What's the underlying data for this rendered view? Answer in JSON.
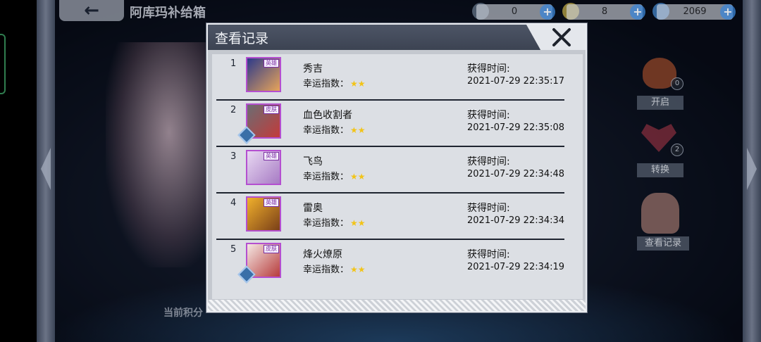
{
  "topbar": {
    "shop_title": "阿库玛补给箱",
    "resources": [
      {
        "icon": "ticket-icon",
        "value": "0"
      },
      {
        "icon": "feather-icon",
        "value": "8"
      },
      {
        "icon": "diamond-icon",
        "value": "2069"
      }
    ],
    "plus_label": "+"
  },
  "side_menu": {
    "open": {
      "label": "开启",
      "badge": "0"
    },
    "exchange": {
      "label": "转换",
      "badge": "2"
    },
    "records": {
      "label": "查看记录"
    }
  },
  "score_label": "当前积分",
  "modal": {
    "title": "查看记录",
    "close_icon": "close-x-icon",
    "rows": [
      {
        "rank": "1",
        "name": "秀吉",
        "luck_label": "幸运指数：",
        "stars": "★★",
        "time_label": "获得时间:",
        "time": "2021-07-29 22:35:17",
        "tag": "英雄",
        "avatar_colors": [
          "#2d3a8a",
          "#e6a35a"
        ],
        "gem": false
      },
      {
        "rank": "2",
        "name": "血色收割者",
        "luck_label": "幸运指数：",
        "stars": "★★",
        "time_label": "获得时间:",
        "time": "2021-07-29 22:35:08",
        "tag": "皮肤",
        "avatar_colors": [
          "#6b6d73",
          "#c23b3b"
        ],
        "gem": true
      },
      {
        "rank": "3",
        "name": "飞鸟",
        "luck_label": "幸运指数：",
        "stars": "★★",
        "time_label": "获得时间:",
        "time": "2021-07-29 22:34:48",
        "tag": "英雄",
        "avatar_colors": [
          "#e8d8f2",
          "#a77bc4"
        ],
        "gem": false
      },
      {
        "rank": "4",
        "name": "雷奥",
        "luck_label": "幸运指数：",
        "stars": "★★",
        "time_label": "获得时间:",
        "time": "2021-07-29 22:34:34",
        "tag": "英雄",
        "avatar_colors": [
          "#f0b02c",
          "#7a3f18"
        ],
        "gem": false
      },
      {
        "rank": "5",
        "name": "烽火燎原",
        "luck_label": "幸运指数：",
        "stars": "★★",
        "time_label": "获得时间:",
        "time": "2021-07-29 22:34:19",
        "tag": "皮肤",
        "avatar_colors": [
          "#f4e8e4",
          "#b73c3c"
        ],
        "gem": true
      }
    ]
  }
}
